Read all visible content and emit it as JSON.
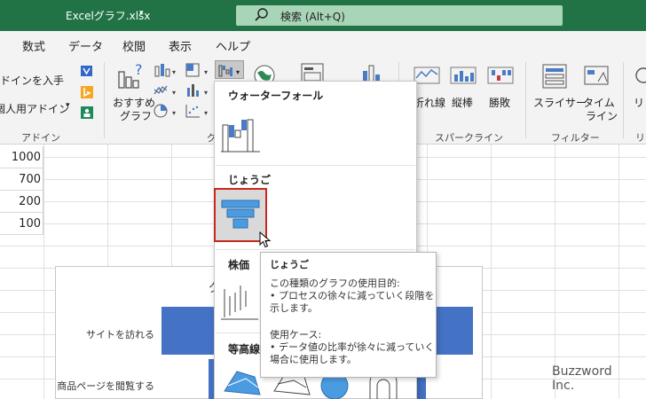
{
  "titlebar": {
    "file_name": "Excelグラフ.xlsx",
    "search_label": "検索 (Alt+Q)"
  },
  "ribbon": {
    "tabs": [
      "数式",
      "データ",
      "校閲",
      "表示",
      "ヘルプ"
    ],
    "addins": {
      "get_addins": "ドインを入手",
      "personal_addins": "個人用アドイン",
      "group_label": "アドイン"
    },
    "recommended_charts": [
      "おすすめ",
      "グラフ"
    ],
    "charts_group_label_partial": "グ",
    "sparklines": {
      "items": [
        "折れ線",
        "縦棒",
        "勝敗"
      ],
      "group_label": "スパークライン"
    },
    "filters": {
      "slicer": "スライサー",
      "timeline": [
        "タイム",
        "ライン"
      ],
      "group_label": "フィルター"
    },
    "links_partial": [
      "リン",
      "リ"
    ]
  },
  "sheet": {
    "values": [
      "1000",
      "700",
      "200",
      "100"
    ]
  },
  "chart": {
    "title_partial": "グ"
  },
  "chart_data": {
    "type": "bar",
    "categories": [
      "サイトを訪れる",
      "商品ページを閲覧する"
    ],
    "title": ""
  },
  "dropdown": {
    "sections": [
      "ウォーターフォール",
      "じょうご",
      "株価",
      "等高線"
    ]
  },
  "tooltip": {
    "title": "じょうご",
    "purpose_heading": "この種類のグラフの使用目的:",
    "purpose_lines": [
      "• プロセスの徐々に減っていく段階を",
      "示します。"
    ],
    "usecase_heading": "使用ケース:",
    "usecase_lines": [
      "• データ値の比率が徐々に減っていく",
      "場合に使用します。"
    ]
  },
  "watermark": "Buzzword Inc.",
  "colors": {
    "titlebar": "#217346",
    "funnel_blue": "#4472c4",
    "selection_red": "#c42b1c"
  }
}
